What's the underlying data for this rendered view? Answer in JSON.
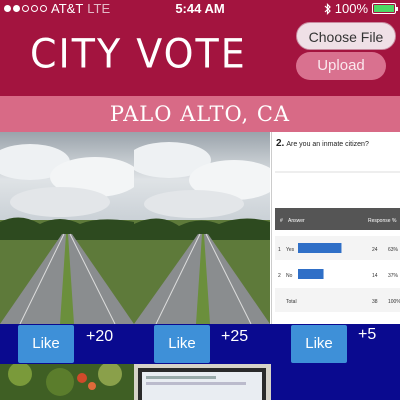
{
  "status_bar": {
    "carrier": "AT&T",
    "network": "LTE",
    "time": "5:44 AM",
    "battery": "100%"
  },
  "header": {
    "title": "CITY VOTE",
    "choose_file_label": "Choose File",
    "upload_label": "Upload"
  },
  "location": "PALO ALTO, CA",
  "posts": [
    {
      "like_label": "Like",
      "count": "+20"
    },
    {
      "like_label": "Like",
      "count": "+25"
    },
    {
      "like_label": "Like",
      "count": "+5"
    }
  ],
  "survey_thumb": {
    "question_number": "2.",
    "question": "Are you an inmate citizen?",
    "table_header": [
      "#",
      "Answer",
      "Response",
      "%"
    ],
    "rows": [
      {
        "num": "1",
        "answer": "Yes",
        "response": "24",
        "pct": "63%",
        "share": 0.63
      },
      {
        "num": "2",
        "answer": "No",
        "response": "14",
        "pct": "37%",
        "share": 0.37
      },
      {
        "num": "",
        "answer": "Total",
        "response": "38",
        "pct": "100%",
        "share": null
      }
    ]
  },
  "colors": {
    "header": "#a3143f",
    "location_bar": "#d86a86",
    "like_bar": "#0a0a8f",
    "like_button": "#3e90d8",
    "battery": "#4cd964"
  }
}
